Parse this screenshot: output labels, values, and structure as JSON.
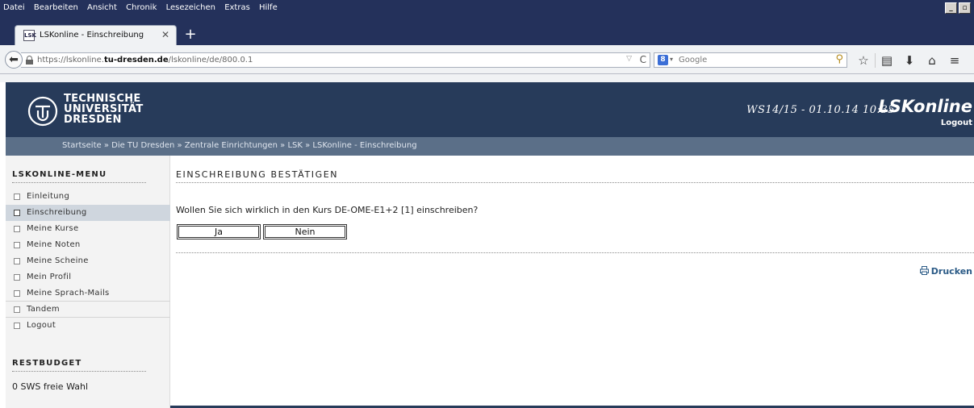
{
  "browser": {
    "menu": [
      "Datei",
      "Bearbeiten",
      "Ansicht",
      "Chronik",
      "Lesezeichen",
      "Extras",
      "Hilfe"
    ],
    "tab_title": "LSKonline - Einschreibung",
    "tab_favicon": "LSK",
    "url_host_prefix": "https://lskonline.",
    "url_host_bold": "tu-dresden.de",
    "url_path": "/lskonline/de/800.0.1",
    "search_placeholder": "Google",
    "search_engine_icon": "8",
    "icons": [
      "back-arrow-icon",
      "lock-icon",
      "reload-icon",
      "search-icon",
      "star-icon",
      "reading-list-icon",
      "download-icon",
      "home-icon",
      "menu-icon"
    ]
  },
  "header": {
    "uni_line1": "TECHNISCHE",
    "uni_line2": "UNIVERSITÄT",
    "uni_line3": "DRESDEN",
    "semester": "WS14/15 - 01.10.14 10:35",
    "app_name": "LSKonline",
    "logout": "Logout",
    "bg_color": "#273b5a"
  },
  "breadcrumb": "Startseite » Die TU Dresden » Zentrale Einrichtungen » LSK » LSKonline - Einschreibung",
  "sidebar": {
    "menu_heading": "LSKONLINE-MENU",
    "items": [
      {
        "label": "Einleitung"
      },
      {
        "label": "Einschreibung"
      },
      {
        "label": "Meine Kurse"
      },
      {
        "label": "Meine Noten"
      },
      {
        "label": "Meine Scheine"
      },
      {
        "label": "Mein Profil"
      },
      {
        "label": "Meine Sprach-Mails"
      },
      {
        "label": "Tandem"
      },
      {
        "label": "Logout"
      }
    ],
    "active_item": "Einschreibung",
    "budget_heading": "RESTBUDGET",
    "budget_value": "0 SWS freie Wahl"
  },
  "main": {
    "title": "EINSCHREIBUNG BESTÄTIGEN",
    "question": "Wollen Sie sich wirklich in den Kurs DE-OME-E1+2 [1] einschreiben?",
    "yes_label": "Ja",
    "no_label": "Nein",
    "print_label": "Drucken"
  }
}
